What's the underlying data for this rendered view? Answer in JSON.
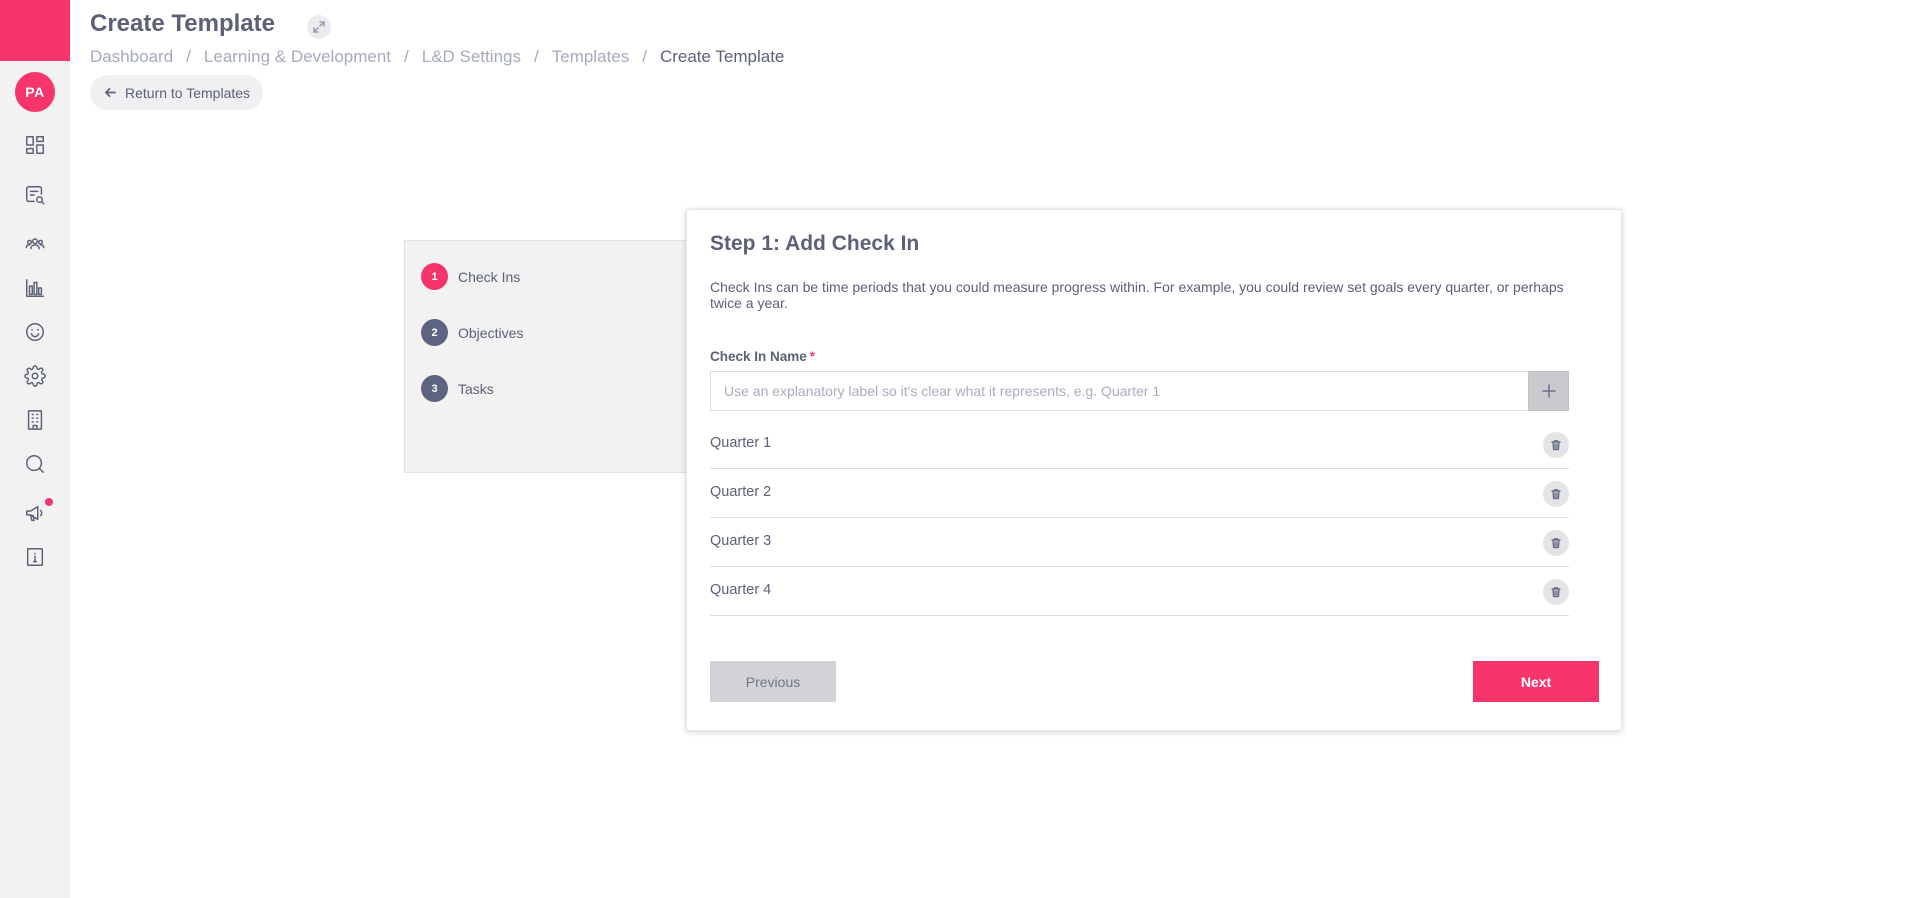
{
  "sidebar": {
    "avatar_initials": "PA",
    "brand_color": "#f5356c",
    "nav": [
      {
        "name": "dashboard-icon"
      },
      {
        "name": "reviews-search-icon"
      },
      {
        "name": "people-icon"
      },
      {
        "name": "analytics-icon"
      },
      {
        "name": "mood-icon"
      },
      {
        "name": "settings-gear-icon"
      },
      {
        "name": "building-icon"
      },
      {
        "name": "search-icon"
      },
      {
        "name": "megaphone-icon",
        "has_notification": true
      },
      {
        "name": "info-book-icon"
      }
    ]
  },
  "header": {
    "title": "Create Template",
    "breadcrumb": [
      "Dashboard",
      "Learning & Development",
      "L&D Settings",
      "Templates",
      "Create Template"
    ],
    "return_label": "Return to Templates"
  },
  "steps": [
    {
      "number": "1",
      "label": "Check Ins",
      "active": true
    },
    {
      "number": "2",
      "label": "Objectives",
      "active": false
    },
    {
      "number": "3",
      "label": "Tasks",
      "active": false
    }
  ],
  "form": {
    "title": "Step 1: Add Check In",
    "description": "Check Ins can be time periods that you could measure progress within. For example, you could review set goals every quarter, or perhaps twice a year.",
    "field_label": "Check In Name",
    "required_mark": "*",
    "placeholder": "Use an explanatory label so it's clear what it represents, e.g. Quarter 1",
    "value": "",
    "check_ins": [
      "Quarter 1",
      "Quarter 2",
      "Quarter 3",
      "Quarter 4"
    ],
    "previous_label": "Previous",
    "next_label": "Next"
  }
}
